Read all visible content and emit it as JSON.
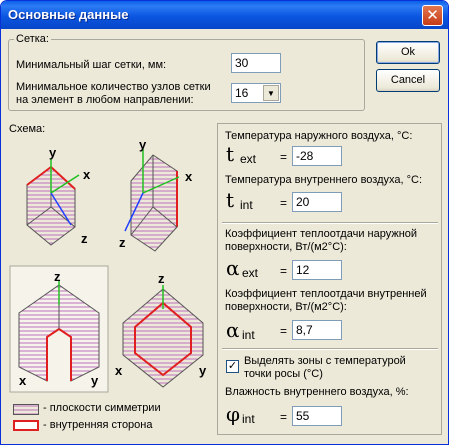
{
  "window": {
    "title": "Основные данные",
    "close_glyph": "✕"
  },
  "buttons": {
    "ok_label": "Ok",
    "cancel_label": "Cancel"
  },
  "grid": {
    "legend": "Сетка:",
    "step_label": "Минимальный шаг сетки, мм:",
    "step_value": "30",
    "nodes_label_1": "Минимальное количество узлов сетки",
    "nodes_label_2": "на элемент в любом направлении:",
    "nodes_value": "16"
  },
  "scheme": {
    "legend": "Схема:",
    "legend_symmetry": "- плоскости симметрии",
    "legend_inner": "- внутренняя сторона",
    "axis_y": "y",
    "axis_x": "x",
    "axis_z": "z",
    "colors": {
      "symmetry": "#c070c0",
      "inner": "#e02020",
      "axis_green": "#20c020",
      "axis_blue": "#2040ff"
    }
  },
  "params": {
    "t_ext_label": "Температура наружного воздуха, °C:",
    "t_ext_symbol": "t",
    "t_ext_sub": "ext",
    "t_ext_value": "-28",
    "t_int_label": "Температура внутреннего воздуха, °C:",
    "t_int_symbol": "t",
    "t_int_sub": "int",
    "t_int_value": "20",
    "a_ext_label_1": "Коэффициент теплоотдачи наружной",
    "a_ext_label_2": "поверхности, Вт/(м2°C):",
    "a_ext_symbol": "α",
    "a_ext_sub": "ext",
    "a_ext_value": "12",
    "a_int_label_1": "Коэффициент теплоотдачи внутренней",
    "a_int_label_2": "поверхности, Вт/(м2°C):",
    "a_int_symbol": "α",
    "a_int_sub": "int",
    "a_int_value": "8,7",
    "dew_check_mark": "✓",
    "dew_label_1": "Выделять зоны с температурой",
    "dew_label_2": "точки росы (°C)",
    "humidity_label": "Влажность внутреннего воздуха, %:",
    "phi_symbol": "φ",
    "phi_sub": "int",
    "phi_value": "55",
    "eq": "="
  }
}
